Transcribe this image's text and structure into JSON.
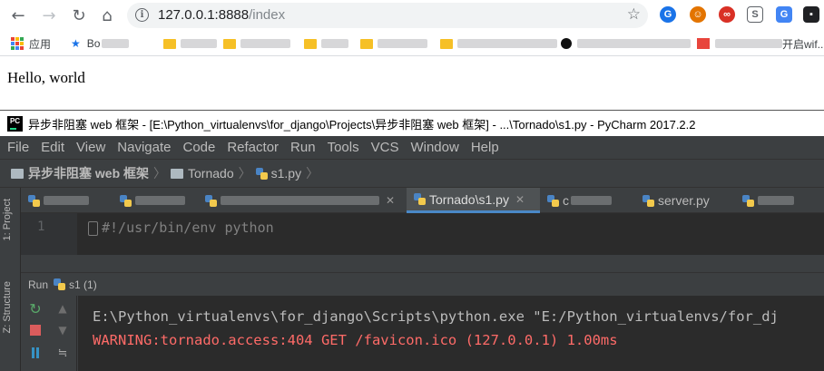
{
  "browser": {
    "url_host": "127.0.0.1:8888",
    "url_path": "/index",
    "nav": {
      "back": "←",
      "forward": "→",
      "reload": "↻",
      "home": "⌂"
    },
    "bookmark_star": "☆",
    "info_icon": "i",
    "extensions": [
      {
        "label": "G",
        "color": "#1a73e8"
      },
      {
        "label": "☺",
        "color": "#e37400"
      },
      {
        "label": "∞",
        "color": "#d93025"
      },
      {
        "label": "S",
        "color": "#5f6368"
      },
      {
        "label": "G",
        "color": "#4285f4"
      },
      {
        "label": "▪",
        "color": "#202124"
      }
    ],
    "bookmarks": {
      "apps_label": "应用",
      "star_item": "Bo",
      "last_item_suffix": "开启wif..."
    }
  },
  "page": {
    "hello": "Hello, world"
  },
  "pycharm": {
    "logo": "PC",
    "title": "异步非阻塞 web 框架 - [E:\\Python_virtualenvs\\for_django\\Projects\\异步非阻塞 web 框架] - ...\\Tornado\\s1.py - PyCharm 2017.2.2",
    "menu": [
      "File",
      "Edit",
      "View",
      "Navigate",
      "Code",
      "Refactor",
      "Run",
      "Tools",
      "VCS",
      "Window",
      "Help"
    ],
    "breadcrumb": [
      "异步非阻塞 web 框架",
      "Tornado",
      "s1.py"
    ],
    "side_tabs": [
      "1: Project",
      "Z: Structure"
    ],
    "editor_tabs": {
      "active": "Tornado\\s1.py",
      "partial_3": "c",
      "partial_4": "server.py"
    },
    "editor": {
      "line_number": "1",
      "code": "#!/usr/bin/env python"
    },
    "run": {
      "label": "Run",
      "config": "s1 (1)"
    },
    "console": {
      "line1": "E:\\Python_virtualenvs\\for_django\\Scripts\\python.exe \"E:/Python_virtualenvs/for_dj",
      "line2": "WARNING:tornado.access:404 GET /favicon.ico (127.0.0.1) 1.00ms"
    },
    "colors": {
      "background": "#3c3f41",
      "editor_bg": "#2b2b2b",
      "warning": "#ff6b68",
      "active_tab_underline": "#4a88c7"
    }
  }
}
